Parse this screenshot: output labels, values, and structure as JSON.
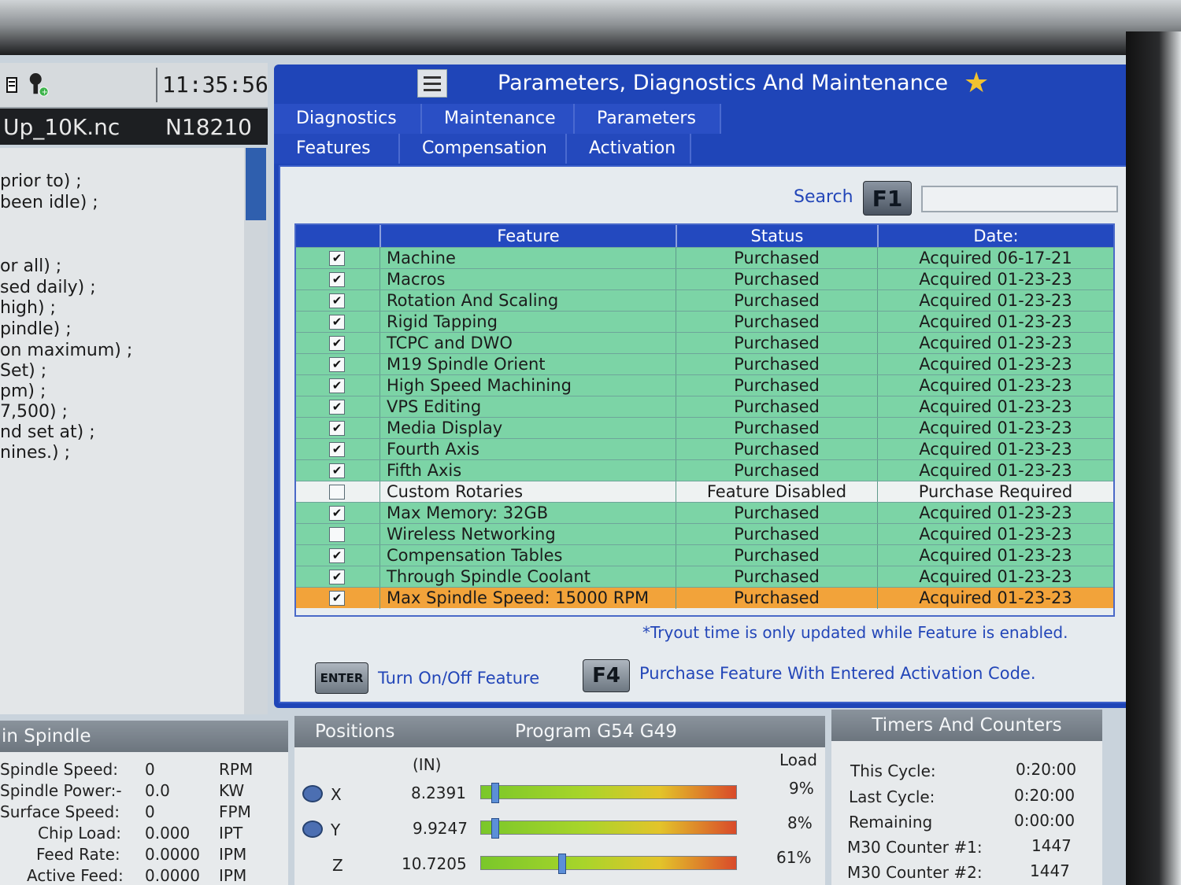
{
  "header": {
    "clock": "11:35:56",
    "program_name": "Up_10K.nc",
    "block_number": "N18210"
  },
  "code_lines": [
    "prior to) ;",
    "been idle) ;",
    "or all) ;",
    "sed daily) ;",
    "high) ;",
    "pindle) ;",
    "on maximum) ;",
    "Set) ;",
    "pm) ;",
    "7,500) ;",
    "nd set at) ;",
    "nines.) ;"
  ],
  "dialog": {
    "title": "Parameters, Diagnostics And Maintenance",
    "tabs_row1": [
      "Diagnostics",
      "Maintenance",
      "Parameters"
    ],
    "tabs_row2": [
      "Features",
      "Compensation",
      "Activation"
    ],
    "search_label": "Search",
    "search_key": "F1",
    "search_value": ""
  },
  "table": {
    "headers": [
      "Feature",
      "Status",
      "Date:"
    ],
    "rows": [
      {
        "checked": true,
        "feature": "Machine",
        "status": "Purchased",
        "date": "Acquired 06-17-21",
        "style": "green"
      },
      {
        "checked": true,
        "feature": "Macros",
        "status": "Purchased",
        "date": "Acquired 01-23-23",
        "style": "green"
      },
      {
        "checked": true,
        "feature": "Rotation And Scaling",
        "status": "Purchased",
        "date": "Acquired 01-23-23",
        "style": "green"
      },
      {
        "checked": true,
        "feature": "Rigid Tapping",
        "status": "Purchased",
        "date": "Acquired 01-23-23",
        "style": "green"
      },
      {
        "checked": true,
        "feature": "TCPC and DWO",
        "status": "Purchased",
        "date": "Acquired 01-23-23",
        "style": "green"
      },
      {
        "checked": true,
        "feature": "M19 Spindle Orient",
        "status": "Purchased",
        "date": "Acquired 01-23-23",
        "style": "green"
      },
      {
        "checked": true,
        "feature": "High Speed Machining",
        "status": "Purchased",
        "date": "Acquired 01-23-23",
        "style": "green"
      },
      {
        "checked": true,
        "feature": "VPS Editing",
        "status": "Purchased",
        "date": "Acquired 01-23-23",
        "style": "green"
      },
      {
        "checked": true,
        "feature": "Media Display",
        "status": "Purchased",
        "date": "Acquired 01-23-23",
        "style": "green"
      },
      {
        "checked": true,
        "feature": "Fourth Axis",
        "status": "Purchased",
        "date": "Acquired 01-23-23",
        "style": "green"
      },
      {
        "checked": true,
        "feature": "Fifth Axis",
        "status": "Purchased",
        "date": "Acquired 01-23-23",
        "style": "green"
      },
      {
        "checked": false,
        "feature": "Custom Rotaries",
        "status": "Feature Disabled",
        "date": "Purchase Required",
        "style": "white"
      },
      {
        "checked": true,
        "feature": "Max Memory: 32GB",
        "status": "Purchased",
        "date": "Acquired 01-23-23",
        "style": "green"
      },
      {
        "checked": false,
        "feature": "Wireless Networking",
        "status": "Purchased",
        "date": "Acquired 01-23-23",
        "style": "green"
      },
      {
        "checked": true,
        "feature": "Compensation Tables",
        "status": "Purchased",
        "date": "Acquired 01-23-23",
        "style": "green"
      },
      {
        "checked": true,
        "feature": "Through Spindle Coolant",
        "status": "Purchased",
        "date": "Acquired 01-23-23",
        "style": "green"
      },
      {
        "checked": true,
        "feature": "Max Spindle Speed: 15000 RPM",
        "status": "Purchased",
        "date": "Acquired 01-23-23",
        "style": "orange"
      }
    ]
  },
  "footer": {
    "note": "*Tryout time is only updated while Feature is enabled.",
    "enter_key": "ENTER",
    "enter_text": "Turn On/Off Feature",
    "f4_key": "F4",
    "f4_text": "Purchase Feature With Entered Activation Code."
  },
  "spindle": {
    "title": "in Spindle",
    "rows": [
      {
        "label": "Spindle Speed:",
        "value": "0",
        "unit": "RPM"
      },
      {
        "label": "Spindle Power:-",
        "value": "0.0",
        "unit": "KW"
      },
      {
        "label": "Surface Speed:",
        "value": "0",
        "unit": "FPM"
      },
      {
        "label": "Chip Load:",
        "value": "0.000",
        "unit": "IPT"
      },
      {
        "label": "Feed Rate:",
        "value": "0.0000",
        "unit": "IPM"
      },
      {
        "label": "Active Feed:",
        "value": "0.0000",
        "unit": "IPM"
      }
    ]
  },
  "positions": {
    "title": "Positions",
    "program": "Program G54 G49",
    "unit_label": "(IN)",
    "load_label": "Load",
    "axes": [
      {
        "axis": "X",
        "value": "8.2391",
        "load": "9%",
        "load_fraction": 0.04
      },
      {
        "axis": "Y",
        "value": "9.9247",
        "load": "8%",
        "load_fraction": 0.04
      },
      {
        "axis": "Z",
        "value": "10.7205",
        "load": "61%",
        "load_fraction": 0.31
      }
    ]
  },
  "timers": {
    "title": "Timers And Counters",
    "rows": [
      {
        "label": "This Cycle:",
        "value": "0:20:00"
      },
      {
        "label": "Last Cycle:",
        "value": "0:20:00"
      },
      {
        "label": "Remaining",
        "value": "0:00:00"
      },
      {
        "label": "M30 Counter #1:",
        "value": "1447"
      },
      {
        "label": "M30 Counter #2:",
        "value": "1447"
      }
    ]
  },
  "colors": {
    "accent_blue": "#1f45b8",
    "row_green": "#7cd4a6",
    "row_selected": "#f2a33a",
    "star": "#f2c230"
  }
}
